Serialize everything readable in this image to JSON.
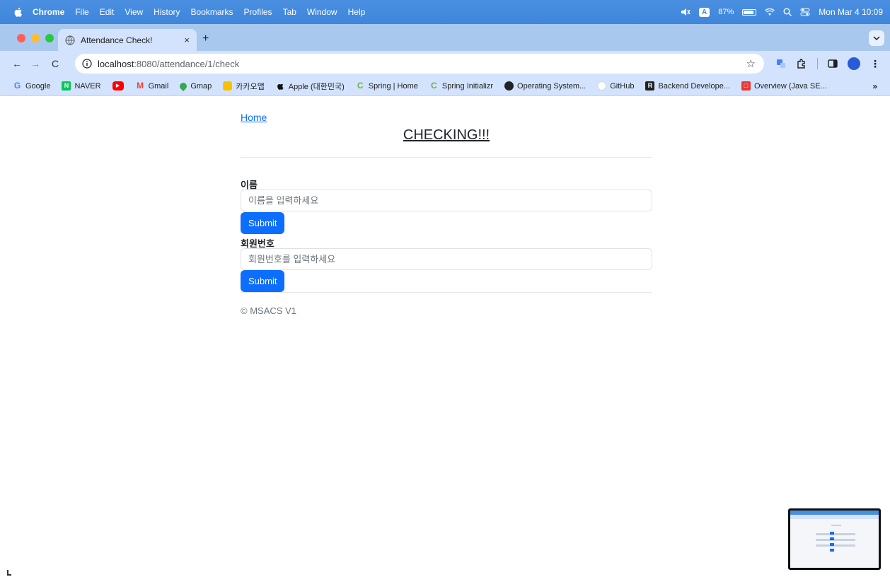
{
  "menubar": {
    "app": "Chrome",
    "items": [
      "File",
      "Edit",
      "View",
      "History",
      "Bookmarks",
      "Profiles",
      "Tab",
      "Window",
      "Help"
    ],
    "keyboard_badge": "A",
    "battery": "87%",
    "clock": "Mon Mar 4  10:09"
  },
  "browser": {
    "tab_title": "Attendance Check!",
    "tab_close": "×",
    "new_tab": "+",
    "url_host": "localhost",
    "url_path": ":8080/attendance/1/check",
    "bookmarks": [
      {
        "label": "Google",
        "icon": "G",
        "color": "#4285f4"
      },
      {
        "label": "NAVER",
        "icon": "N",
        "color": "#03c75a"
      },
      {
        "label": "",
        "icon": "▶",
        "color": "#ff0000"
      },
      {
        "label": "Gmail",
        "icon": "M",
        "color": "#ea4335"
      },
      {
        "label": "Gmap",
        "icon": "●",
        "color": "#34a853"
      },
      {
        "label": "카카오맵",
        "icon": "●",
        "color": "#f9c000"
      },
      {
        "label": "Apple (대한민국)",
        "icon": "",
        "color": "#111111"
      },
      {
        "label": "Spring | Home",
        "icon": "C",
        "color": "#6db33f"
      },
      {
        "label": "Spring Initializr",
        "icon": "C",
        "color": "#6db33f"
      },
      {
        "label": "Operating System...",
        "icon": "●",
        "color": "#222222"
      },
      {
        "label": "GitHub",
        "icon": "●",
        "color": "#ffffff"
      },
      {
        "label": "Backend Develope...",
        "icon": "R",
        "color": "#222222"
      },
      {
        "label": "Overview (Java SE...",
        "icon": "□",
        "color": "#e53935"
      }
    ],
    "bookmarks_more": "»"
  },
  "page": {
    "home_link": "Home",
    "title": "CHECKING!!!",
    "name_label": "이름",
    "name_placeholder": "이름을 입력하세요",
    "submit1": "Submit",
    "member_label": "회원번호",
    "member_placeholder": "회원번호를 입력하세요",
    "submit2": "Submit",
    "footer": "© MSACS V1"
  },
  "colors": {
    "accent": "#0d6efd",
    "menubar": "#3e86dc",
    "tabstrip": "#a9c8ee",
    "toolbar": "#d3e3fd"
  }
}
